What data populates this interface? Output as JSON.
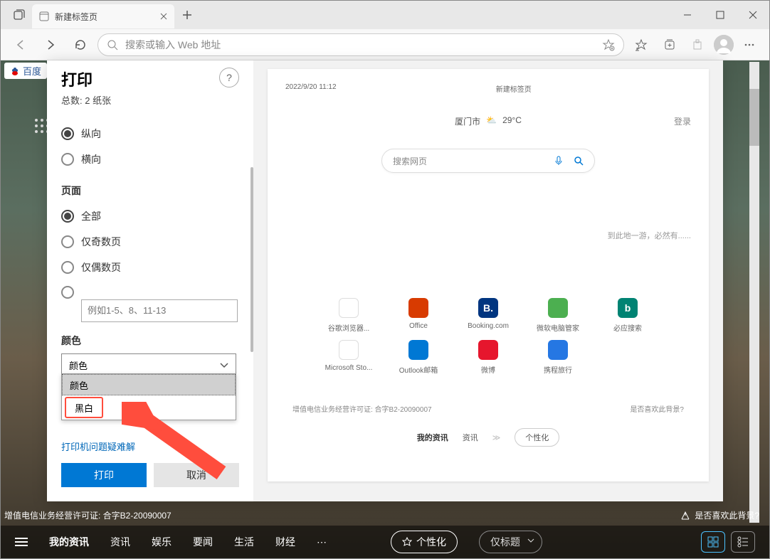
{
  "titlebar": {
    "tab_title": "新建标签页"
  },
  "toolbar": {
    "address_placeholder": "搜索或输入 Web 地址"
  },
  "bg": {
    "site_name": "百度",
    "license": "增值电信业务经营许可证: 合字B2-20090007",
    "like_label": "是否喜欢此背景?",
    "nav": {
      "my_news": "我的资讯",
      "news": "资讯",
      "entertainment": "娱乐",
      "headline": "要闻",
      "life": "生活",
      "finance": "财经"
    },
    "personalize": "个性化",
    "title_only": "仅标题"
  },
  "print": {
    "title": "打印",
    "subtitle": "总数: 2 纸张",
    "orientation": {
      "portrait": "纵向",
      "landscape": "横向"
    },
    "pages": {
      "label": "页面",
      "all": "全部",
      "odd": "仅奇数页",
      "even": "仅偶数页",
      "range_placeholder": "例如1-5、8、11-13"
    },
    "color": {
      "label": "颜色",
      "selected": "颜色",
      "option_color": "颜色",
      "option_bw": "黑白"
    },
    "troubleshoot": "打印机问题疑难解",
    "print_btn": "打印",
    "cancel_btn": "取消"
  },
  "preview": {
    "timestamp": "2022/9/20 11:12",
    "page_title": "新建标签页",
    "city": "厦门市",
    "temp": "29°C",
    "login": "登录",
    "search_placeholder": "搜索网页",
    "placeholder_line": "到此地一游，必然有......",
    "tiles": [
      {
        "label": "谷歌浏览器...",
        "color": "#fff",
        "letter": ""
      },
      {
        "label": "Office",
        "color": "#d83b01",
        "letter": ""
      },
      {
        "label": "Booking.com",
        "color": "#003580",
        "letter": "B."
      },
      {
        "label": "微软电脑管家",
        "color": "#4caf50",
        "letter": ""
      },
      {
        "label": "必应搜索",
        "color": "#008373",
        "letter": "b"
      },
      {
        "label": "Microsoft Sto...",
        "color": "#fff",
        "letter": ""
      },
      {
        "label": "Outlook邮箱",
        "color": "#0078d4",
        "letter": ""
      },
      {
        "label": "微博",
        "color": "#e6162d",
        "letter": ""
      },
      {
        "label": "携程旅行",
        "color": "#2577e3",
        "letter": ""
      }
    ],
    "footer_license": "增值电信业务经营许可证: 合字B2-20090007",
    "footer_like": "是否喜欢此背景?",
    "bottom_nav": {
      "my_news": "我的资讯",
      "news": "资讯",
      "personalize": "个性化"
    }
  }
}
